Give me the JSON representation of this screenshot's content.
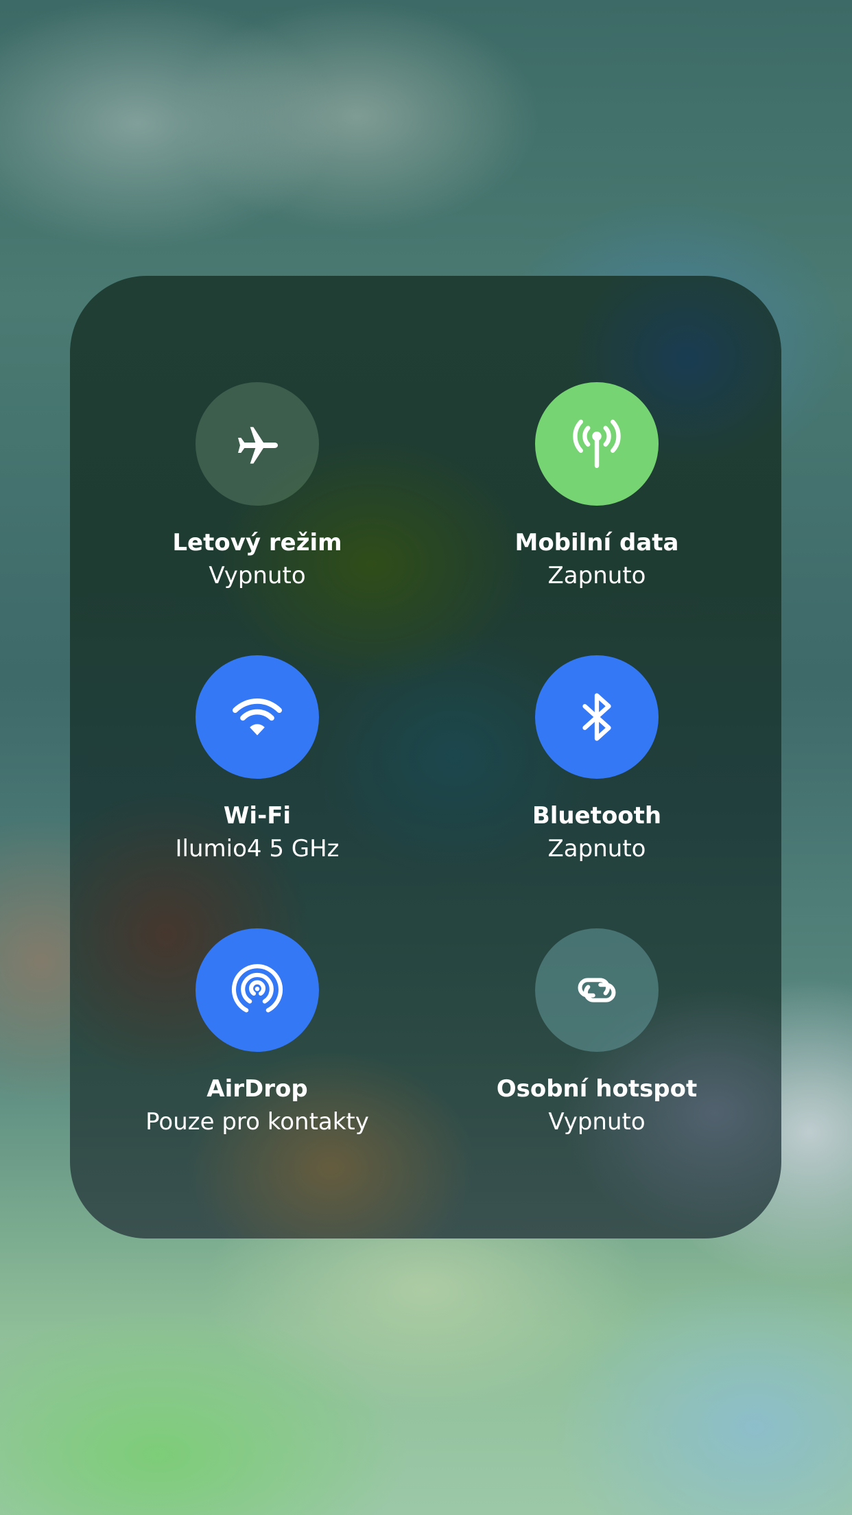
{
  "colors": {
    "active_blue": "#3478f6",
    "active_green": "#76d572"
  },
  "connectivity": {
    "airplane": {
      "label": "Letový režim",
      "status": "Vypnuto",
      "icon": "airplane-icon",
      "state": "off"
    },
    "cellular": {
      "label": "Mobilní data",
      "status": "Zapnuto",
      "icon": "antenna-icon",
      "state": "on"
    },
    "wifi": {
      "label": "Wi-Fi",
      "status": "Ilumio4 5 GHz",
      "icon": "wifi-icon",
      "state": "on"
    },
    "bluetooth": {
      "label": "Bluetooth",
      "status": "Zapnuto",
      "icon": "bluetooth-icon",
      "state": "on"
    },
    "airdrop": {
      "label": "AirDrop",
      "status": "Pouze pro kontakty",
      "icon": "airdrop-icon",
      "state": "on"
    },
    "hotspot": {
      "label": "Osobní hotspot",
      "status": "Vypnuto",
      "icon": "hotspot-link-icon",
      "state": "off"
    }
  }
}
